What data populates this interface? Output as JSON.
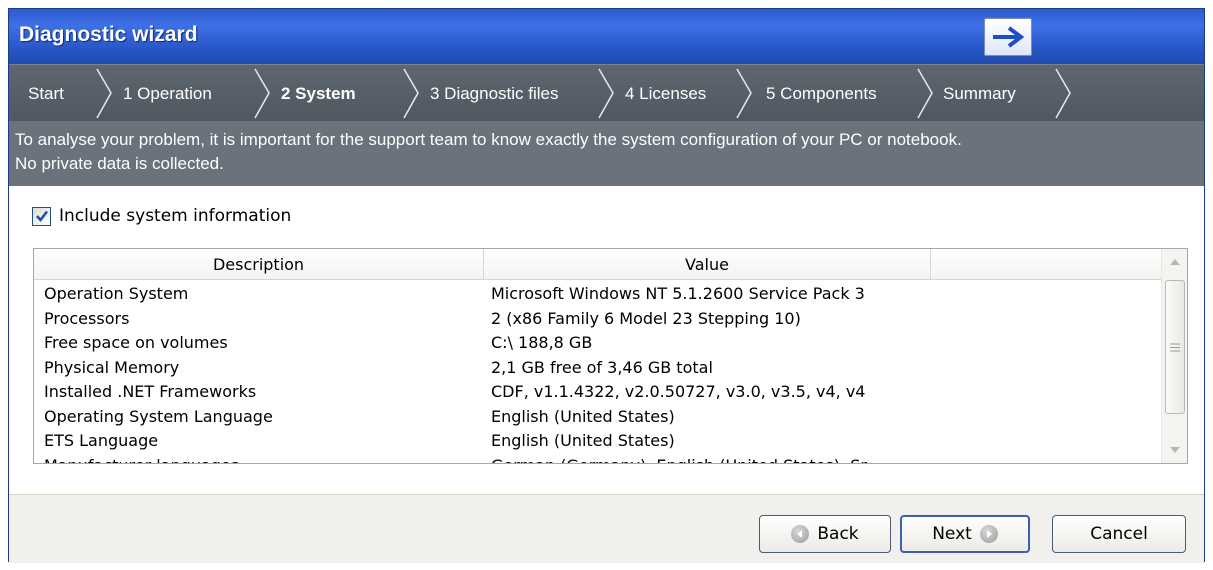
{
  "window": {
    "title": "Diagnostic wizard"
  },
  "steps": [
    {
      "label": "Start",
      "active": false
    },
    {
      "label": "1 Operation",
      "active": false
    },
    {
      "label": "2 System",
      "active": true
    },
    {
      "label": "3 Diagnostic files",
      "active": false
    },
    {
      "label": "4 Licenses",
      "active": false
    },
    {
      "label": "5 Components",
      "active": false
    },
    {
      "label": "Summary",
      "active": false
    }
  ],
  "info": {
    "line1": "To analyse your problem, it is important for the support team to know exactly the system configuration of your PC or notebook.",
    "line2": "No private data is collected."
  },
  "include_checkbox": {
    "label": "Include system information",
    "checked": true
  },
  "table": {
    "columns": [
      "Description",
      "Value"
    ],
    "rows": [
      [
        "Operation System",
        "Microsoft Windows NT 5.1.2600 Service Pack 3"
      ],
      [
        "Processors",
        "2 (x86 Family 6 Model 23 Stepping 10)"
      ],
      [
        "Free space on volumes",
        "C:\\ 188,8 GB"
      ],
      [
        "Physical Memory",
        "2,1 GB free of 3,46 GB total"
      ],
      [
        "Installed .NET Frameworks",
        "CDF, v1.1.4322, v2.0.50727, v3.0, v3.5, v4, v4"
      ],
      [
        "Operating System Language",
        "English (United States)"
      ],
      [
        "ETS Language",
        "English (United States)"
      ],
      [
        "Manufacturer languages",
        "German (Germany), English (United States), Sr"
      ]
    ]
  },
  "buttons": {
    "back": "Back",
    "next": "Next",
    "cancel": "Cancel"
  },
  "icons": {
    "forward": "arrow-right-icon",
    "back": "circle-arrow-left-icon",
    "next": "circle-arrow-right-icon"
  },
  "colors": {
    "titlebar": "#2e5bd0",
    "stepbar": "#57606a",
    "infobar": "#6a727c",
    "checkbox_tick": "#2150a8"
  }
}
